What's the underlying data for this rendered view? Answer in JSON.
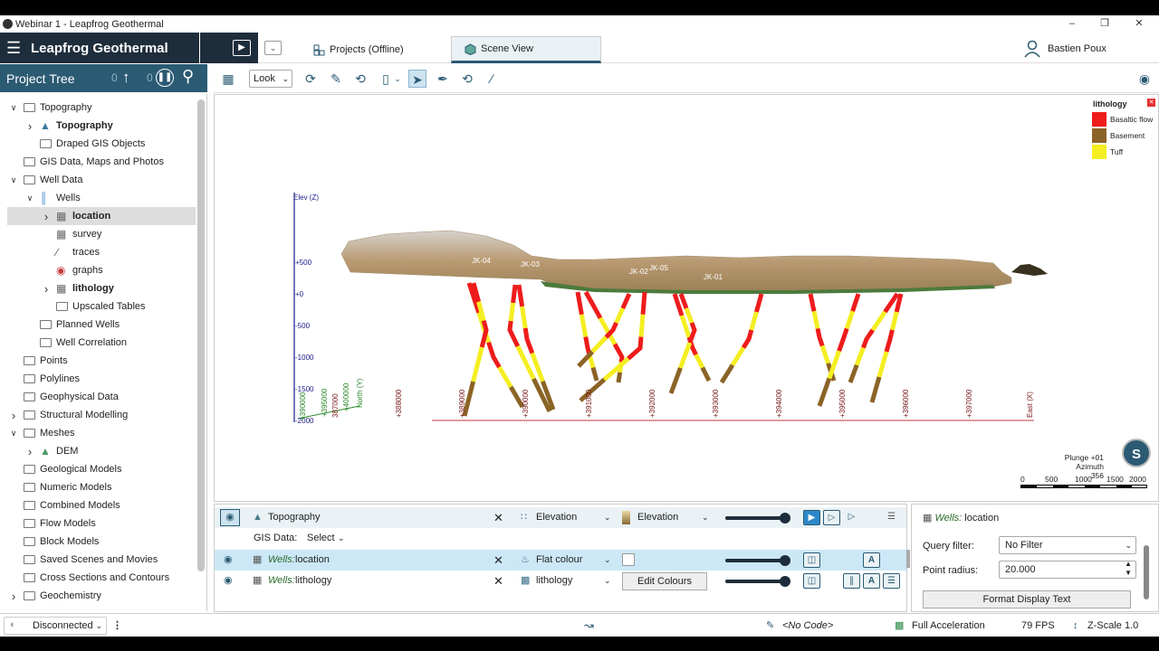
{
  "window": {
    "title": "Webinar 1 - Leapfrog Geothermal"
  },
  "app": {
    "brand": "Leapfrog Geothermal"
  },
  "tabs": {
    "projects": "Projects (Offline)",
    "scene": "Scene View"
  },
  "user": {
    "name": "Bastien Poux"
  },
  "project_tree": {
    "title": "Project Tree",
    "counter_up": "0",
    "counter_pause": "0",
    "items": [
      {
        "label": "Topography",
        "level": 1,
        "expanded": true,
        "icon": "folder-icon"
      },
      {
        "label": "Topography",
        "level": 2,
        "collapsed": true,
        "bold": true,
        "icon": "topography-icon"
      },
      {
        "label": "Draped GIS Objects",
        "level": 2,
        "icon": "folder-icon"
      },
      {
        "label": "GIS Data, Maps and Photos",
        "level": 1,
        "icon": "folder-icon"
      },
      {
        "label": "Well Data",
        "level": 1,
        "expanded": true,
        "icon": "folder-icon"
      },
      {
        "label": "Wells",
        "level": 2,
        "expanded": true,
        "icon": "wells-icon"
      },
      {
        "label": "location",
        "level": 3,
        "collapsed": true,
        "bold": true,
        "selected": true,
        "icon": "table-icon"
      },
      {
        "label": "survey",
        "level": 3,
        "icon": "table-icon"
      },
      {
        "label": "traces",
        "level": 3,
        "icon": "traces-icon"
      },
      {
        "label": "graphs",
        "level": 3,
        "icon": "graphs-icon"
      },
      {
        "label": "lithology",
        "level": 3,
        "collapsed": true,
        "bold": true,
        "icon": "table-icon"
      },
      {
        "label": "Upscaled Tables",
        "level": 3,
        "icon": "folder-icon"
      },
      {
        "label": "Planned Wells",
        "level": 2,
        "icon": "folder-icon"
      },
      {
        "label": "Well Correlation",
        "level": 2,
        "icon": "folder-icon"
      },
      {
        "label": "Points",
        "level": 1,
        "icon": "folder-icon"
      },
      {
        "label": "Polylines",
        "level": 1,
        "icon": "folder-icon"
      },
      {
        "label": "Geophysical Data",
        "level": 1,
        "icon": "folder-icon"
      },
      {
        "label": "Structural Modelling",
        "level": 1,
        "collapsed": true,
        "icon": "folder-icon"
      },
      {
        "label": "Meshes",
        "level": 1,
        "expanded": true,
        "icon": "folder-icon"
      },
      {
        "label": "DEM",
        "level": 2,
        "collapsed": true,
        "icon": "mesh-icon"
      },
      {
        "label": "Geological Models",
        "level": 1,
        "icon": "folder-icon"
      },
      {
        "label": "Numeric Models",
        "level": 1,
        "icon": "folder-icon"
      },
      {
        "label": "Combined Models",
        "level": 1,
        "icon": "folder-icon"
      },
      {
        "label": "Flow Models",
        "level": 1,
        "icon": "folder-icon"
      },
      {
        "label": "Block Models",
        "level": 1,
        "icon": "folder-icon"
      },
      {
        "label": "Saved Scenes and Movies",
        "level": 1,
        "icon": "folder-icon"
      },
      {
        "label": "Cross Sections and Contours",
        "level": 1,
        "icon": "folder-icon"
      },
      {
        "label": "Geochemistry",
        "level": 1,
        "collapsed": true,
        "icon": "folder-icon"
      }
    ]
  },
  "toolbar": {
    "look_label": "Look"
  },
  "scene": {
    "axis_z_title": "Elev (Z)",
    "z_ticks": [
      "+500",
      "+0",
      "-500",
      "-1000",
      "-1500",
      "-2000"
    ],
    "y_ticks": [
      "+390000",
      "+395000",
      "+400000",
      "North (Y)"
    ],
    "x_ticks": [
      "387000",
      "+388000",
      "+389000",
      "+390000",
      "+391000",
      "+392000",
      "+393000",
      "+394000",
      "+395000",
      "+396000",
      "+397000",
      "East (X)"
    ],
    "well_labels": [
      "JK-04",
      "JK-03",
      "JK-02",
      "JK-05",
      "JK-01"
    ],
    "colors": {
      "basaltic": "#ee1c1c",
      "basement": "#8b6326",
      "tuff": "#f4ee22",
      "axis": "#1a1a8c",
      "x_axis": "#7a1a1a"
    }
  },
  "legend": {
    "title": "lithology",
    "items": [
      {
        "label": "Basaltic flow",
        "color": "#ee1c1c"
      },
      {
        "label": "Basement",
        "color": "#8b6326"
      },
      {
        "label": "Tuff",
        "color": "#f4ee22"
      }
    ]
  },
  "orientation": {
    "plunge": "Plunge +01",
    "azimuth": "Azimuth 356",
    "compass_letter": "S"
  },
  "scalebar": {
    "ticks": [
      "0",
      "500",
      "1000",
      "1500",
      "2000"
    ]
  },
  "layers": {
    "gis_label": "GIS Data:",
    "gis_value": "Select",
    "rows": [
      {
        "name": "Topography",
        "prefix": "",
        "colour_mode": "Elevation",
        "colour_value": "Elevation"
      },
      {
        "name": "location",
        "prefix": "Wells:",
        "colour_mode": "Flat colour",
        "colour_value": ""
      },
      {
        "name": "lithology",
        "prefix": "Wells:",
        "colour_mode": "lithology",
        "colour_value": "Edit Colours"
      }
    ]
  },
  "properties": {
    "title_prefix": "Wells:",
    "title_name": "location",
    "query_filter_label": "Query filter:",
    "query_filter_value": "No Filter",
    "point_radius_label": "Point radius:",
    "point_radius_value": "20.000",
    "format_button": "Format Display Text"
  },
  "status": {
    "connection": "Disconnected",
    "code": "<No Code>",
    "acceleration": "Full Acceleration",
    "fps": "79 FPS",
    "zscale": "Z-Scale 1.0"
  }
}
